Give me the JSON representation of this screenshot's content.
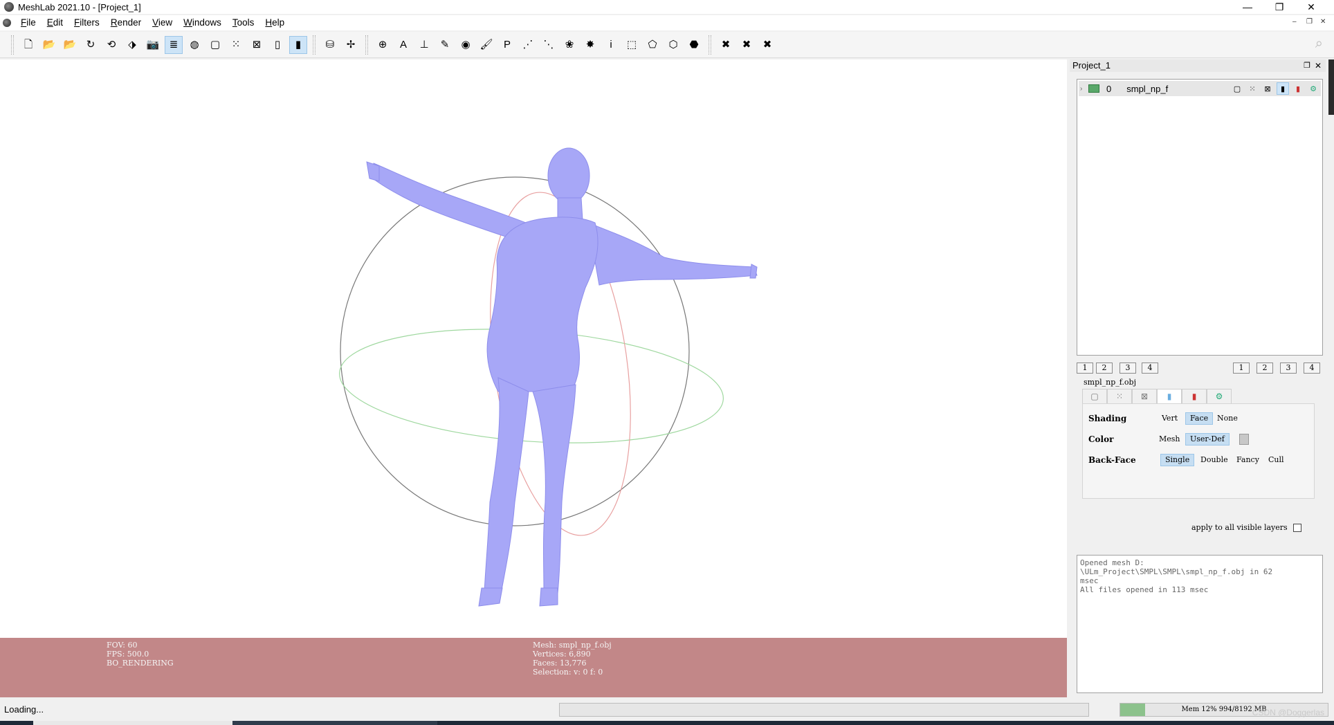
{
  "window": {
    "title": "MeshLab 2021.10 - [Project_1]",
    "controls": {
      "minimize": "—",
      "restore": "❐",
      "close": "✕"
    },
    "mdi_controls": {
      "minimize": "–",
      "restore": "❐",
      "close": "✕"
    }
  },
  "menu": [
    "File",
    "Edit",
    "Filters",
    "Render",
    "View",
    "Windows",
    "Tools",
    "Help"
  ],
  "toolbar": {
    "groups": [
      [
        {
          "icon": "new-project-icon",
          "glyph": "🗋"
        },
        {
          "icon": "open-project-icon",
          "glyph": "📂"
        },
        {
          "icon": "import-mesh-icon",
          "glyph": "📂"
        },
        {
          "icon": "reload-icon",
          "glyph": "↻"
        },
        {
          "icon": "reload-all-icon",
          "glyph": "⟲"
        },
        {
          "icon": "export-mesh-icon",
          "glyph": "⬗"
        },
        {
          "icon": "snapshot-icon",
          "glyph": "📷"
        },
        {
          "icon": "layers-icon",
          "glyph": "≣",
          "active": true
        },
        {
          "icon": "raster-icon",
          "glyph": "◍"
        },
        {
          "icon": "bbox-icon",
          "glyph": "▢"
        },
        {
          "icon": "points-icon",
          "glyph": "⁙"
        },
        {
          "icon": "wireframe-icon",
          "glyph": "⊠"
        },
        {
          "icon": "flat-shading-icon",
          "glyph": "▯"
        },
        {
          "icon": "smooth-shading-icon",
          "glyph": "▮",
          "active": true
        }
      ],
      [
        {
          "icon": "light-icon",
          "glyph": "⛁"
        },
        {
          "icon": "axis-icon",
          "glyph": "✢"
        }
      ],
      [
        {
          "icon": "trackball-icon",
          "glyph": "⊕"
        },
        {
          "icon": "annotate-icon",
          "glyph": "A"
        },
        {
          "icon": "measure-icon",
          "glyph": "⊥"
        },
        {
          "icon": "align-icon",
          "glyph": "✎"
        },
        {
          "icon": "camera-icon",
          "glyph": "◉"
        },
        {
          "icon": "paint-icon",
          "glyph": "🖌"
        },
        {
          "icon": "pickpoints-icon",
          "glyph": "P"
        },
        {
          "icon": "select-vertices-icon",
          "glyph": "⋰"
        },
        {
          "icon": "select-faces-icon",
          "glyph": "⋱"
        },
        {
          "icon": "select-components-icon",
          "glyph": "❀"
        },
        {
          "icon": "georef-icon",
          "glyph": "✸"
        },
        {
          "icon": "info-icon",
          "glyph": "i"
        },
        {
          "icon": "select-rect-icon",
          "glyph": "⬚"
        },
        {
          "icon": "select-poly-icon",
          "glyph": "⬠"
        },
        {
          "icon": "select-conn-icon",
          "glyph": "⬡"
        },
        {
          "icon": "select-region-icon",
          "glyph": "⬣"
        }
      ],
      [
        {
          "icon": "delete-vertices-icon",
          "glyph": "✖"
        },
        {
          "icon": "delete-faces-icon",
          "glyph": "✖"
        },
        {
          "icon": "delete-all-icon",
          "glyph": "✖"
        }
      ]
    ]
  },
  "viewport": {
    "info_left": [
      "FOV: 60",
      "FPS:   500.0",
      "BO_RENDERING"
    ],
    "info_right": [
      "Mesh: smpl_np_f.obj",
      "Vertices: 6,890",
      "Faces: 13,776",
      "Selection: v: 0 f: 0"
    ],
    "mesh_color": "#a7a7f7",
    "info_bar_color": "#c28788"
  },
  "dock": {
    "title": "Project_1",
    "layer": {
      "index": "0",
      "name": "smpl_np_f"
    },
    "raster_buttons_left": [
      "1",
      "2",
      "3",
      "4"
    ],
    "raster_buttons_right": [
      "1",
      "2",
      "3",
      "4"
    ],
    "file_label": "smpl_np_f.obj",
    "render": {
      "shading": {
        "label": "Shading",
        "options": [
          "Vert",
          "Face",
          "None"
        ],
        "selected": "Face"
      },
      "color": {
        "label": "Color",
        "options": [
          "Mesh",
          "User-Def"
        ],
        "selected": "User-Def"
      },
      "backface": {
        "label": "Back-Face",
        "options": [
          "Single",
          "Double",
          "Fancy",
          "Cull"
        ],
        "selected": "Single"
      },
      "apply_label": "apply to all visible layers"
    },
    "log": "Opened mesh D:\n\\ULm_Project\\SMPL\\SMPL\\smpl_np_f.obj in 62\nmsec\nAll files opened in 113 msec"
  },
  "status": {
    "text": "Loading...",
    "mem": "Mem 12% 994/8192 MB",
    "mem_percent": 12,
    "watermark": "CSDN @Doggerlas"
  }
}
